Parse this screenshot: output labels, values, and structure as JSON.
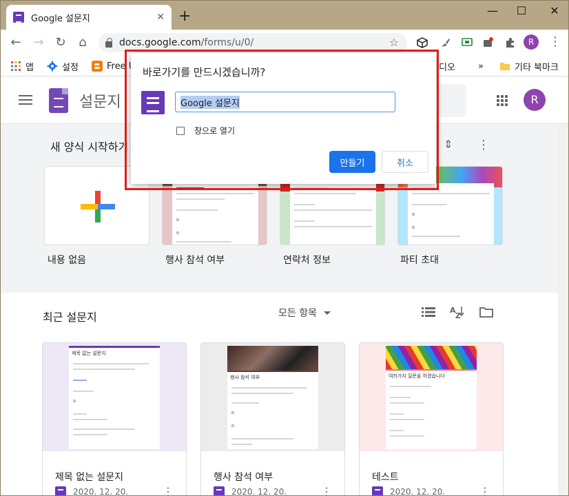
{
  "browser": {
    "tab_title": "Google 설문지",
    "tab_close": "✕",
    "new_tab": "+",
    "url_host": "docs.google.com",
    "url_path": "/forms/u/0/",
    "profile_initial": "R",
    "window_minimize": "—",
    "window_maximize": "☐",
    "window_close": "✕"
  },
  "bookmarks": [
    {
      "label": "앱"
    },
    {
      "label": "설정"
    },
    {
      "label": "Free U"
    },
    {
      "label": "디오"
    },
    {
      "label": "»"
    },
    {
      "label": "기타 북마크"
    }
  ],
  "app": {
    "title": "설문지",
    "avatar_initial": "R"
  },
  "gallery": {
    "title": "새 양식 시작하기",
    "templates": [
      {
        "label": "내용 없음"
      },
      {
        "label": "행사 참석 여부"
      },
      {
        "label": "연락처 정보"
      },
      {
        "label": "파티 초대"
      }
    ]
  },
  "recent": {
    "title": "최근 설문지",
    "sort_label": "모든 항목",
    "docs": [
      {
        "title": "제목 없는 설문지",
        "date": "2020. 12. 20.",
        "thumb_heading": "제목 없는 설문지"
      },
      {
        "title": "행사 참석 여부",
        "date": "2020. 12. 20.",
        "thumb_heading": "행사 참석 여부"
      },
      {
        "title": "테스트",
        "date": "2020. 12. 20.",
        "thumb_heading": "여러가지 질문을 하겠습니다"
      }
    ]
  },
  "dialog": {
    "title": "바로가기를 만드시겠습니까?",
    "input_value": "Google 설문지",
    "checkbox_label": "창으로 열기",
    "checkbox_checked": false,
    "create_label": "만들기",
    "cancel_label": "취소"
  },
  "colors": {
    "forms_purple": "#673ab7",
    "primary_blue": "#1a73e8",
    "highlight_red": "#e41b17"
  }
}
